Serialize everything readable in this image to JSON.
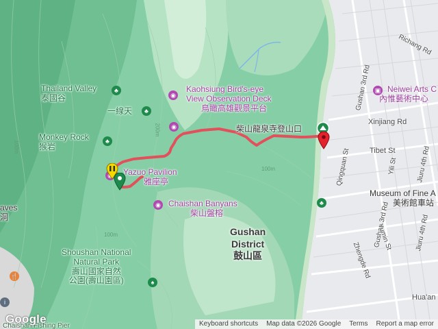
{
  "map": {
    "places": {
      "thailand_valley": {
        "name": "Thailand Valley",
        "local": "泰國谷"
      },
      "yi_xian_tian": {
        "name": "一線天"
      },
      "monkey_rock": {
        "name": "Monkey Rock",
        "local": "猴岩"
      },
      "yazuo_pavilion": {
        "name": "Yazuo Pavilion",
        "local": "雅座亭"
      },
      "birdseye_deck": {
        "name_line1": "Kaohsiung Bird's-eye",
        "name_line2": "View Observation Deck",
        "local": "鳥瞰高雄觀景平台"
      },
      "chaishan_banyans": {
        "name": "Chaishan Banyans",
        "local": "柴山盤榕"
      },
      "trailhead": {
        "name": "柴山龍泉寺登山口"
      },
      "gushan_district": {
        "name_line1": "Gushan",
        "name_line2": "District",
        "local": "鼓山區"
      },
      "shoushan_park": {
        "name_line1": "Shoushan National",
        "name_line2": "Natural Park",
        "local_line1": "壽山國家自然",
        "local_line2": "公園(壽山園區)"
      },
      "neiwei_arts": {
        "name": "Neiwei Arts C",
        "local": "內惟藝術中心"
      },
      "museum_fine_arts": {
        "name": "Museum of Fine A",
        "local": "美術館車站"
      },
      "caves": {
        "name": "aves",
        "local": "洞"
      },
      "chaishan_fishing_pier": {
        "name": "Chaishan Fishing Pier"
      }
    },
    "streets": {
      "gushan_3rd_rd_a": "Gushan 3rd Rd",
      "gushan_3rd_rd_b": "Gushan 3rd Rd",
      "richang_rd": "Richang Rd",
      "xinjiang_rd": "Xinjiang Rd",
      "tibet_st": "Tibet St",
      "qingquan_st": "Qingquan St",
      "yili_st": "Yili St",
      "jiuru_4th_rd_a": "Jiuru 4th Rd",
      "jiuru_4th_rd_b": "Jiuru 4th Rd",
      "yumin_st": "Yumin St",
      "zhengde_rd": "Zhengde Rd",
      "huaan": "Hua'an"
    },
    "contours": {
      "c100_left": "100m",
      "c200": "200m",
      "c100_mid": "100m",
      "c100_low": "100m"
    },
    "footer": {
      "keyboard": "Keyboard shortcuts",
      "mapdata": "Map data ©2026 Google",
      "terms": "Terms",
      "report": "Report a map error"
    },
    "logo": "Google",
    "colors": {
      "route": "#e2505c",
      "start_marker": "#1e8a4c",
      "end_marker": "#e2232e",
      "poi_green": "#1e8a4c",
      "poi_purple": "#b04ab0",
      "pause_marker": "#f5d800"
    }
  }
}
